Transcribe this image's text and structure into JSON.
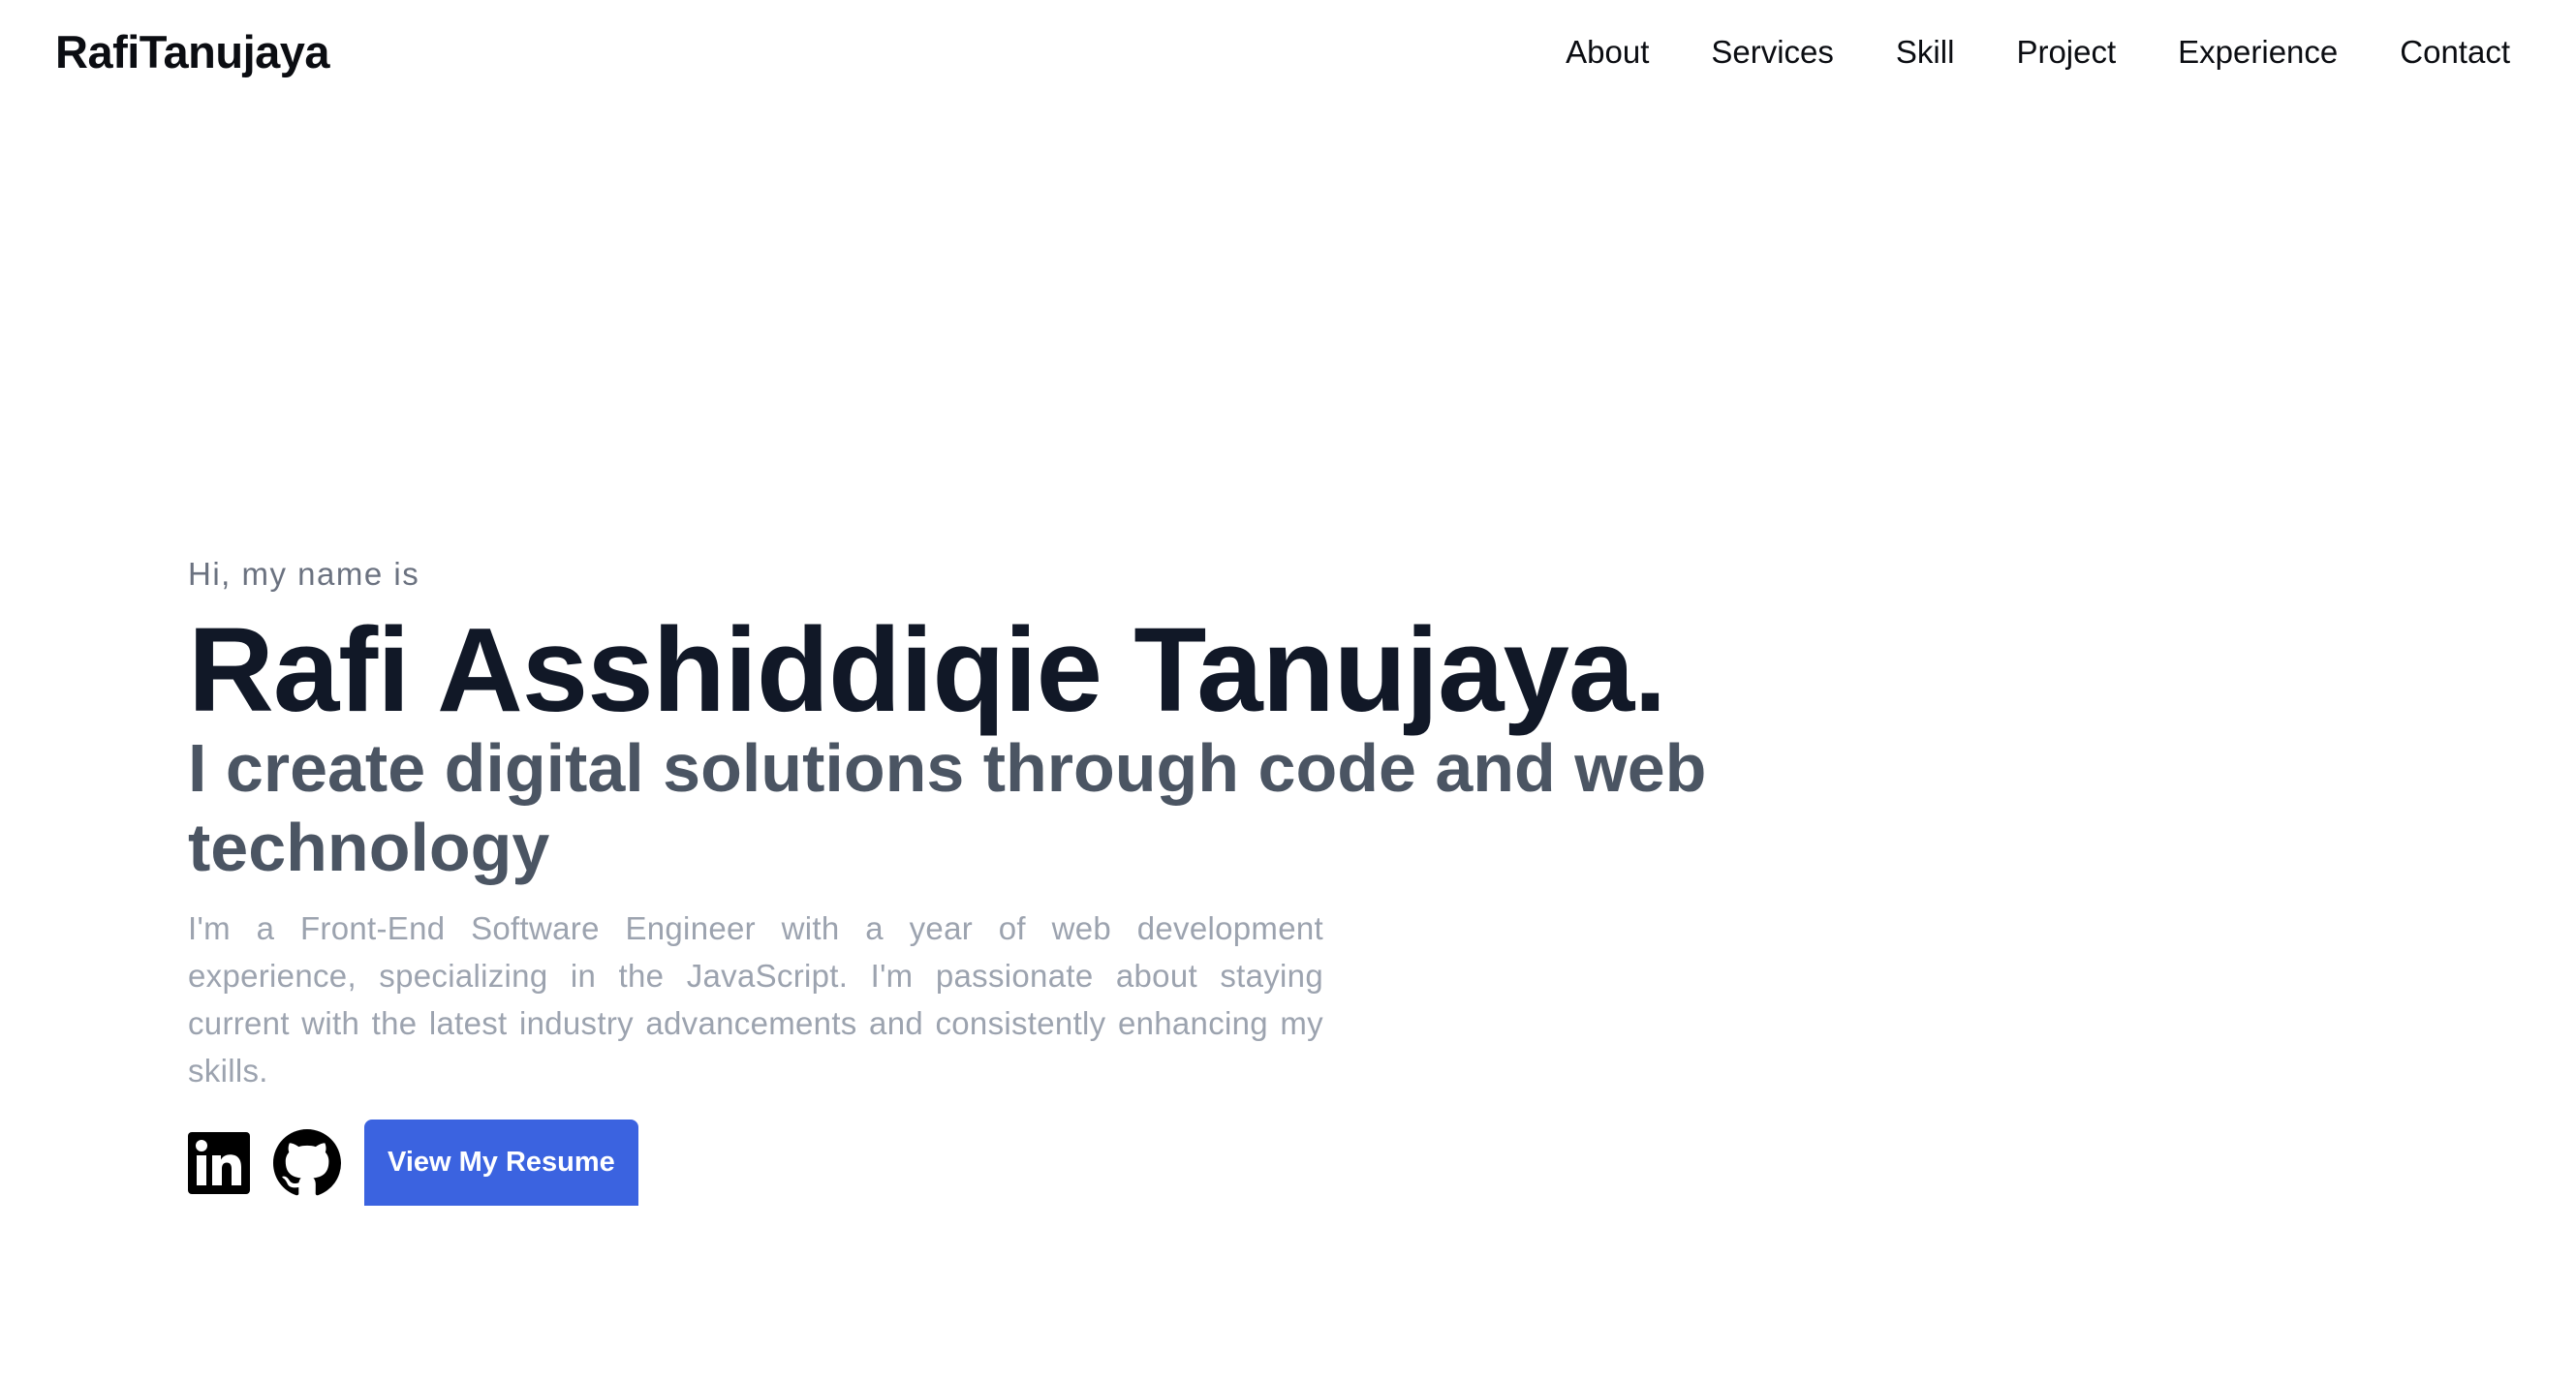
{
  "header": {
    "brand": "RafiTanujaya",
    "nav": [
      "About",
      "Services",
      "Skill",
      "Project",
      "Experience",
      "Contact"
    ]
  },
  "hero": {
    "greeting": "Hi, my name is",
    "name": "Rafi Asshiddiqie Tanujaya.",
    "tagline": "I create digital solutions through code and web technology",
    "description": "I'm a Front-End Software Engineer with a year of web development experience, specializing in the JavaScript. I'm passionate about staying current with the latest industry advancements and consistently enhancing my skills.",
    "icons": [
      "linkedin-icon",
      "github-icon"
    ],
    "resume_button": "View My Resume"
  },
  "colors": {
    "accent": "#3b63e0",
    "heading": "#111827",
    "tagline": "#4b5563",
    "muted": "#9ca3af"
  }
}
